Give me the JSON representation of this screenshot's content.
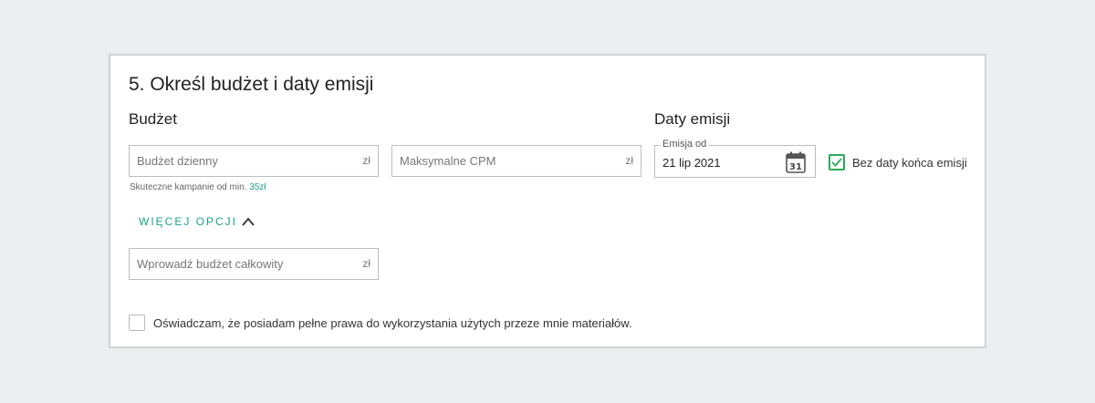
{
  "section": {
    "title": "5. Określ budżet i daty emisji"
  },
  "budget": {
    "heading": "Budżet",
    "daily_placeholder": "Budżet dzienny",
    "daily_unit": "zł",
    "cpm_placeholder": "Maksymalne CPM",
    "cpm_unit": "zł",
    "hint_prefix": "Skuteczne kampanie od min.",
    "hint_amount": "35zł",
    "more_options_label": "WIĘCEJ OPCJI",
    "total_placeholder": "Wprowadź budżet całkowity",
    "total_unit": "zł"
  },
  "dates": {
    "heading": "Daty emisji",
    "from_label": "Emisja od",
    "from_value": "21 lip 2021",
    "calendar_day": "31",
    "no_end_label": "Bez daty końca emisji",
    "no_end_checked": true
  },
  "consent": {
    "label": "Oświadczam, że posiadam pełne prawa do wykorzystania użytych przeze mnie materiałów.",
    "checked": false
  },
  "colors": {
    "accent": "#1aa38a",
    "check": "#2bab57"
  }
}
